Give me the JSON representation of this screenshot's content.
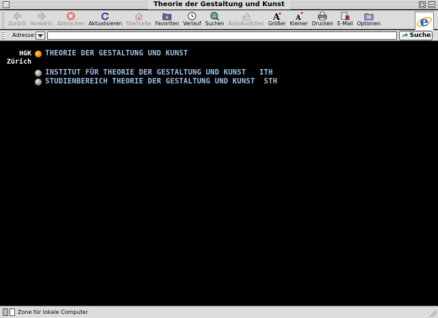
{
  "window": {
    "title": "Theorie der Gestaltung und Kunst"
  },
  "toolbar": {
    "buttons": [
      {
        "label": "Zurück",
        "icon": "back-arrow-icon",
        "enabled": false
      },
      {
        "label": "Vorwärts",
        "icon": "forward-arrow-icon",
        "enabled": false
      },
      {
        "label": "Abbrechen",
        "icon": "stop-icon",
        "enabled": false
      },
      {
        "label": "Aktualisieren",
        "icon": "refresh-icon",
        "enabled": true
      },
      {
        "label": "Startseite",
        "icon": "home-icon",
        "enabled": false
      },
      {
        "label": "Favoriten",
        "icon": "favorites-icon",
        "enabled": true
      },
      {
        "label": "Verlauf",
        "icon": "history-icon",
        "enabled": true
      },
      {
        "label": "Suchen",
        "icon": "search-globe-icon",
        "enabled": true
      },
      {
        "label": "AutoAusfüllen",
        "icon": "autofill-icon",
        "enabled": false
      },
      {
        "label": "Größer",
        "icon": "text-larger-icon",
        "enabled": true
      },
      {
        "label": "Kleiner",
        "icon": "text-smaller-icon",
        "enabled": true
      },
      {
        "label": "Drucken",
        "icon": "print-icon",
        "enabled": true
      },
      {
        "label": "E-Mail",
        "icon": "mail-icon",
        "enabled": true
      },
      {
        "label": "Optionen",
        "icon": "options-icon",
        "enabled": true
      }
    ]
  },
  "address": {
    "label": "Adresse:",
    "value": "",
    "go_label": "Suche"
  },
  "page": {
    "brand_line1": "HGK",
    "brand_line2": "Zürich",
    "links": [
      {
        "text": "THEORIE DER GESTALTUNG UND KUNST",
        "bullet": "orange"
      },
      {
        "text": "INSTITUT FÜR THEORIE DER GESTALTUNG UND KUNST   ITH",
        "bullet": "gray"
      },
      {
        "text": "STUDIENBEREICH THEORIE DER GESTALTUNG UND KUNST  STH",
        "bullet": "gray"
      }
    ],
    "colors": {
      "background": "#000000",
      "link": "#9fc3e6",
      "bullet_active": "#f39a18",
      "bullet_inactive": "#a8a8a8"
    }
  },
  "status": {
    "text": "Zone für lokale Computer"
  }
}
